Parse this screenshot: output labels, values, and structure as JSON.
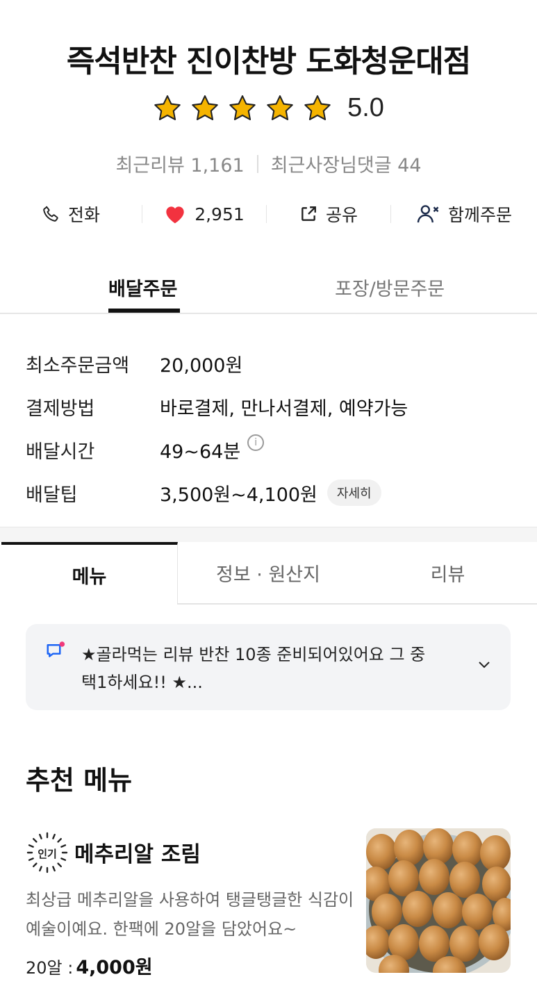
{
  "store": {
    "name": "즉석반찬 진이찬방 도화청운대점",
    "rating": "5.0",
    "rating_stars": 5,
    "recent_reviews": "최근리뷰 1,161",
    "owner_replies": "최근사장님댓글 44"
  },
  "actions": {
    "call": "전화",
    "likes": "2,951",
    "share": "공유",
    "group_order": "함께주문"
  },
  "order_tabs": {
    "delivery": "배달주문",
    "pickup": "포장/방문주문"
  },
  "info": {
    "min_order_label": "최소주문금액",
    "min_order_value": "20,000원",
    "payment_label": "결제방법",
    "payment_value": "바로결제, 만나서결제, 예약가능",
    "delivery_time_label": "배달시간",
    "delivery_time_value": "49~64분",
    "delivery_tip_label": "배달팁",
    "delivery_tip_value": "3,500원~4,100원",
    "detail_button": "자세히"
  },
  "menu_tabs": {
    "menu": "메뉴",
    "info": "정보 · 원산지",
    "review": "리뷰"
  },
  "notice": {
    "text": "★골라먹는 리뷰 반찬 10종 준비되어있어요 그 중 택1하세요!! ★..."
  },
  "recommended": {
    "title": "추천 메뉴",
    "items": [
      {
        "badge": "인기",
        "name": "메추리알 조림",
        "description": "최상급 메추리알을 사용하여 탱글탱글한 식감이 예술이예요. 한팩에 20알을 담았어요~",
        "option": "20알 :",
        "price": "4,000원"
      }
    ]
  },
  "colors": {
    "star": "#f5b400",
    "heart": "#f2323f",
    "accent_blue": "#1e66f5",
    "notice_dot": "#f0397a"
  }
}
